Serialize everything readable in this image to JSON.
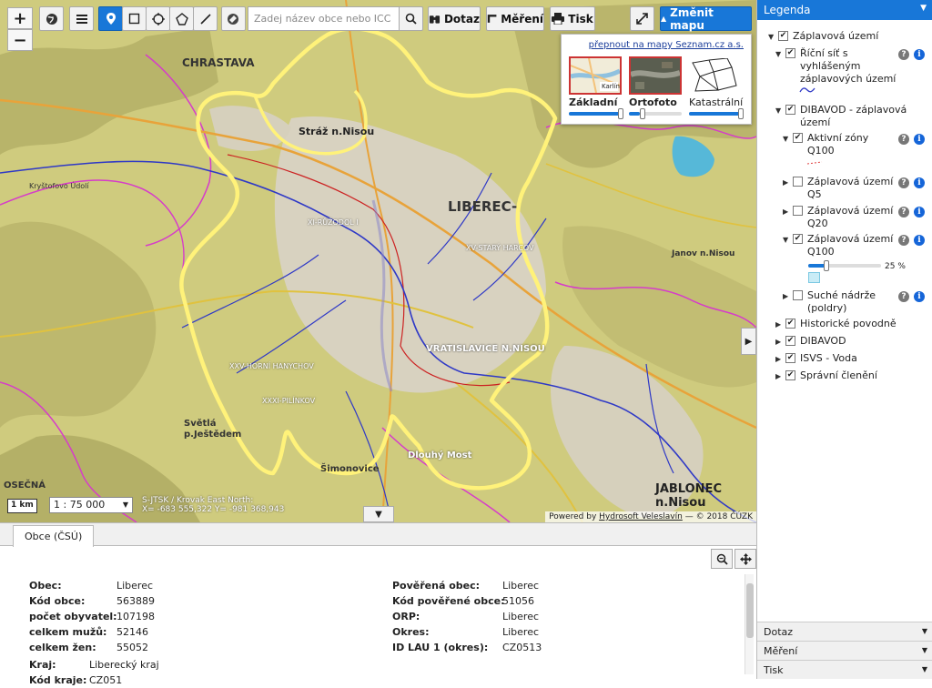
{
  "toolbar": {
    "search_placeholder": "Zadej název obce nebo ICC",
    "query_label": "Dotaz",
    "measure_label": "Měření",
    "print_label": "Tisk",
    "change_map_label": "Změnit mapu"
  },
  "zoom": {
    "in": "+",
    "out": "−"
  },
  "basemap_switcher": {
    "switch_link": "přepnout na mapy Seznam.cz a.s.",
    "options": [
      {
        "label": "Základní",
        "opacity": 1.0
      },
      {
        "label": "Ortofoto",
        "opacity": 0.2
      },
      {
        "label": "Katastrální",
        "opacity": 1.0
      }
    ],
    "thumb_text": "Karlín"
  },
  "map": {
    "scale_bar": "1 km",
    "scale_select": "1 : 75 000",
    "coord_system": "S-JTSK / Krovak East North:",
    "coord_values": "X= -683 555,322 Y= -981 368,943",
    "attribution_prefix": "Powered by",
    "attribution_link": "Hydrosoft Veleslavín",
    "attribution_suffix": "— © 2018 ČÚZK",
    "labels": {
      "chrastava": "CHRASTAVA",
      "straz": "Stráž n.Nisou",
      "liberec": "LIBEREC-",
      "vratislavice": "VRATISLAVICE N.NISOU",
      "jablonec": "JABLONEC n.Nisou",
      "svetla": "Světlá",
      "svetla2": "p.Ještědem",
      "osecna": "OSEČNÁ",
      "simonovice": "Šimonovice",
      "dlouhy": "Dlouhý Most",
      "rozdol": "XI-RŮŽODOL I",
      "starypavel": "XV-STARÝ HARCOV",
      "kryst": "Kryštofovo Údolí",
      "janov": "Janov n.Nisou",
      "hornihanych": "XXV-HORNÍ HANYCHOV",
      "pilinkov": "XXXI-PILÍNKOV"
    }
  },
  "bottom_panel": {
    "tab_label": "Obce (ČSÚ)",
    "left_fields": [
      {
        "key": "Obec:",
        "value": "Liberec"
      },
      {
        "key": "Kód obce:",
        "value": "563889"
      },
      {
        "key": "počet obyvatel:",
        "value": "107198"
      },
      {
        "key": "celkem mužů:",
        "value": "52146"
      },
      {
        "key": "celkem žen:",
        "value": "55052"
      }
    ],
    "left_fields2": [
      {
        "key": "Kraj:",
        "value": "Liberecký kraj"
      },
      {
        "key": "Kód kraje:",
        "value": "CZ051"
      }
    ],
    "right_fields": [
      {
        "key": "Pověřená obec:",
        "value": "Liberec"
      },
      {
        "key": "Kód pověřené obce:",
        "value": "51056"
      },
      {
        "key": "ORP:",
        "value": "Liberec"
      },
      {
        "key": "Okres:",
        "value": "Liberec"
      },
      {
        "key": "ID LAU 1 (okres):",
        "value": "CZ0513"
      }
    ]
  },
  "legend": {
    "title": "Legenda",
    "items": {
      "zaplavova": "Záplavová území",
      "ricni_line1": "Říční síť s",
      "ricni_line2": "vyhlášeným",
      "ricni_line3": "záplavových území",
      "dibavod_line1": "DIBAVOD - záplavová",
      "dibavod_line2": "území",
      "aktivni_line1": "Aktivní zóny",
      "aktivni_line2": "Q100",
      "q5_line1": "Záplavová území",
      "q5_line2": "Q5",
      "q20_line1": "Záplavová území",
      "q20_line2": "Q20",
      "q100_line1": "Záplavová území",
      "q100_line2": "Q100",
      "opacity_value": "25 %",
      "suche_line1": "Suché nádrže",
      "suche_line2": "(poldry)",
      "historicke": "Historické povodně",
      "dibavod": "DIBAVOD",
      "isvs": "ISVS - Voda",
      "spravni": "Správní členění"
    },
    "opacity_fraction": 0.25,
    "accordions": [
      "Dotaz",
      "Měření",
      "Tisk"
    ]
  }
}
